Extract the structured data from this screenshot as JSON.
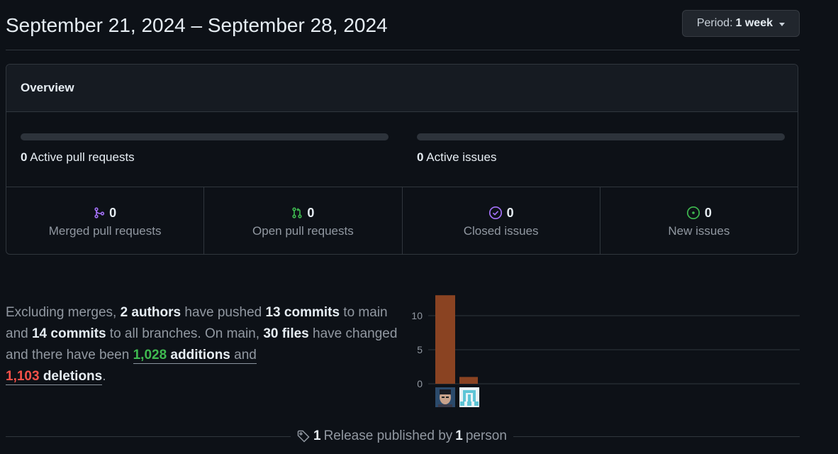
{
  "header": {
    "date_range": "September 21, 2024 – September 28, 2024",
    "period_prefix": "Period:",
    "period_value": "1 week"
  },
  "overview": {
    "title": "Overview",
    "active_pull_requests": {
      "count": "0",
      "label": "Active pull requests"
    },
    "active_issues": {
      "count": "0",
      "label": "Active issues"
    },
    "stats": [
      {
        "icon": "git-merge-icon",
        "count": "0",
        "label": "Merged pull requests",
        "color": "#a371f7"
      },
      {
        "icon": "git-pull-request-icon",
        "count": "0",
        "label": "Open pull requests",
        "color": "#3fb950"
      },
      {
        "icon": "issue-closed-icon",
        "count": "0",
        "label": "Closed issues",
        "color": "#a371f7"
      },
      {
        "icon": "issue-opened-icon",
        "count": "0",
        "label": "New issues",
        "color": "#3fb950"
      }
    ]
  },
  "summary": {
    "t1": "Excluding merges, ",
    "authors": "2 authors",
    "t2": " have pushed ",
    "commits_main": "13 commits",
    "t3": " to main and ",
    "commits_all": "14 commits",
    "t4": " to all branches. On main, ",
    "files": "30 files",
    "t5": " have changed and there have been ",
    "additions_num": "1,028",
    "additions_word": "additions",
    "t6": " and",
    "deletions_num": "1,103",
    "deletions_word": "deletions",
    "t7": "."
  },
  "chart_data": {
    "type": "bar",
    "categories": [
      "author-1",
      "author-2"
    ],
    "values": [
      13,
      1
    ],
    "yticks": [
      0,
      5,
      10
    ],
    "ylim": [
      0,
      13
    ],
    "bar_color": "#8a4322",
    "grid": true
  },
  "release": {
    "count": "1",
    "mid": " Release published by ",
    "people": "1",
    "tail": " person"
  }
}
